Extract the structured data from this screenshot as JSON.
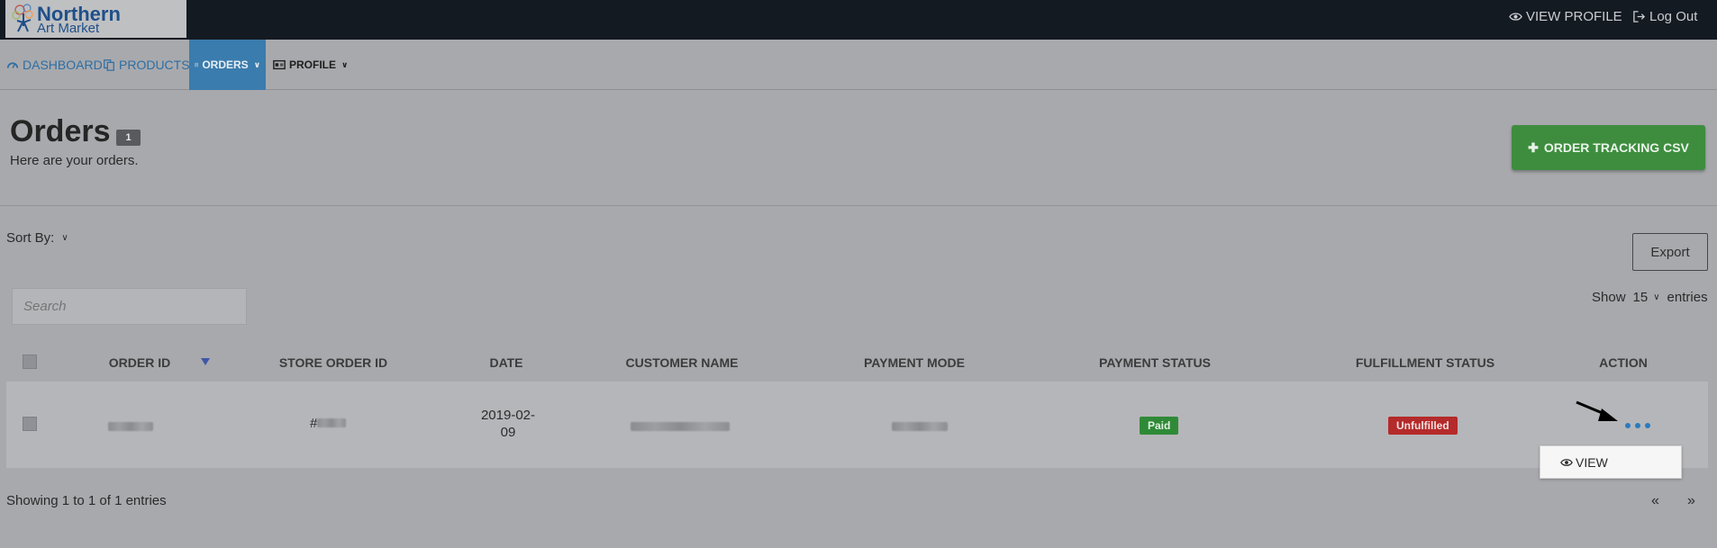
{
  "brand": {
    "line1": "Northern",
    "line2": "Art Market"
  },
  "topnav": {
    "view_profile": "VIEW PROFILE",
    "logout": "Log Out"
  },
  "nav": {
    "dashboard": "DASHBOARD",
    "products": "PRODUCTS",
    "orders": "ORDERS",
    "profile": "PROFILE"
  },
  "page": {
    "title": "Orders",
    "count": "1",
    "subtitle": "Here are your orders.",
    "csv_button": "ORDER TRACKING CSV"
  },
  "controls": {
    "sort_by": "Sort By:",
    "export": "Export",
    "show": "Show",
    "show_value": "15",
    "entries": "entries",
    "search_placeholder": "Search"
  },
  "table": {
    "columns": [
      "ORDER ID",
      "STORE ORDER ID",
      "DATE",
      "CUSTOMER NAME",
      "PAYMENT MODE",
      "PAYMENT STATUS",
      "FULFILLMENT STATUS",
      "ACTION"
    ],
    "rows": [
      {
        "store_order_prefix": "#",
        "date_line1": "2019-02-",
        "date_line2": "09",
        "payment_status": "Paid",
        "fulfillment_status": "Unfulfilled"
      }
    ]
  },
  "action_menu": {
    "view": "VIEW"
  },
  "footer": {
    "info": "Showing 1 to 1 of 1 entries",
    "prev": "«",
    "next": "»"
  },
  "colors": {
    "topbar": "#141a21",
    "active_nav": "#3a7cad",
    "csv_button": "#3e8d3f",
    "paid": "#2f8a37",
    "unfulfilled": "#b52a2a",
    "link": "#2e6ea3"
  }
}
